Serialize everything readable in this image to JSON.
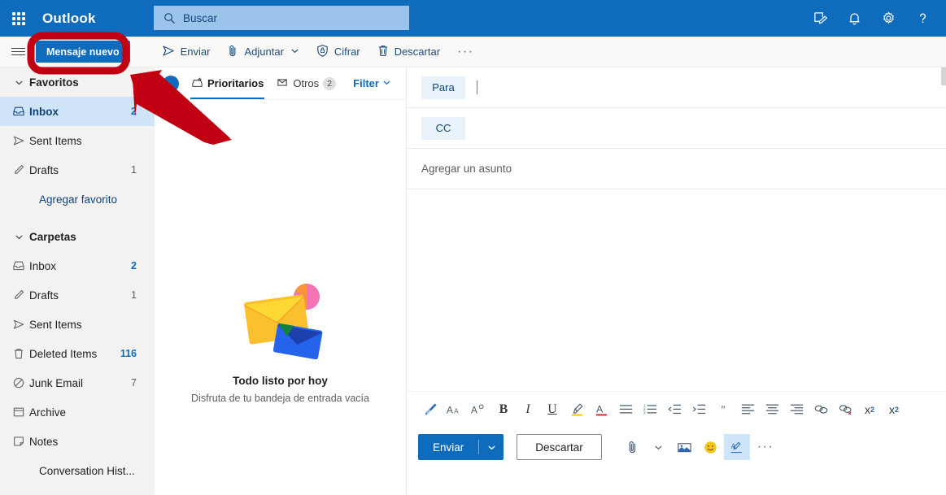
{
  "topbar": {
    "brand": "Outlook",
    "app_launcher_icon": "waffle-grid-icon",
    "search": {
      "placeholder": "Buscar",
      "value": "",
      "icon": "search-icon"
    },
    "icons": [
      {
        "name": "meeting-note-icon",
        "label": "Notas de reunión"
      },
      {
        "name": "bell-icon",
        "label": "Notificaciones"
      },
      {
        "name": "gear-icon",
        "label": "Configuración"
      },
      {
        "name": "help-icon",
        "label": "Ayuda"
      }
    ],
    "accent": "#0f6cbd",
    "search_bg": "#9cc3ea"
  },
  "commandbar": {
    "hamburger_icon": "hamburger-icon",
    "new_message_label": "Mensaje nuevo",
    "actions": [
      {
        "name": "send",
        "label": "Enviar",
        "icon": "send-arrow-icon",
        "chevron": false
      },
      {
        "name": "attach",
        "label": "Adjuntar",
        "icon": "paperclip-icon",
        "chevron": true
      },
      {
        "name": "encrypt",
        "label": "Cifrar",
        "icon": "shield-lock-icon",
        "chevron": false
      },
      {
        "name": "discard",
        "label": "Descartar",
        "icon": "trash-icon",
        "chevron": false
      }
    ],
    "overflow": "···"
  },
  "sidebar": {
    "favorites_group": {
      "label": "Favoritos",
      "chevron": "chevron-down-icon"
    },
    "favorites": [
      {
        "label": "Inbox",
        "count": "2",
        "icon": "inbox-icon",
        "selected": true,
        "count_blue": true
      },
      {
        "label": "Sent Items",
        "count": "",
        "icon": "send-arrow-icon",
        "selected": false,
        "count_blue": false
      },
      {
        "label": "Drafts",
        "count": "1",
        "icon": "pencil-icon",
        "selected": false,
        "count_blue": false
      }
    ],
    "add_favorite_label": "Agregar favorito",
    "folders_group": {
      "label": "Carpetas",
      "chevron": "chevron-down-icon"
    },
    "folders": [
      {
        "label": "Inbox",
        "count": "2",
        "icon": "inbox-icon",
        "count_blue": true
      },
      {
        "label": "Drafts",
        "count": "1",
        "icon": "pencil-icon",
        "count_blue": false
      },
      {
        "label": "Sent Items",
        "count": "",
        "icon": "send-arrow-icon",
        "count_blue": false
      },
      {
        "label": "Deleted Items",
        "count": "116",
        "icon": "trash-icon",
        "count_blue": true
      },
      {
        "label": "Junk Email",
        "count": "7",
        "icon": "block-icon",
        "count_blue": false
      },
      {
        "label": "Archive",
        "count": "",
        "icon": "archive-icon",
        "count_blue": false
      },
      {
        "label": "Notes",
        "count": "",
        "icon": "note-icon",
        "count_blue": false
      }
    ],
    "conversation_history_label": "Conversation Hist...",
    "selected_bg": "#cfe4f7"
  },
  "messagelist": {
    "select_all_icon": "select-circle-icon",
    "tabs": [
      {
        "label": "Prioritarios",
        "icon": "focused-inbox-icon",
        "badge": "",
        "active": true
      },
      {
        "label": "Otros",
        "icon": "other-inbox-icon",
        "badge": "2",
        "active": false
      }
    ],
    "filter": {
      "label": "Filter",
      "chevron": "chevron-down-icon"
    },
    "empty": {
      "illustration": "empty-inbox-envelopes-icon",
      "title": "Todo listo por hoy",
      "subtitle": "Disfruta de tu bandeja de entrada vacía"
    }
  },
  "compose": {
    "to": {
      "chip_label": "Para",
      "value": "",
      "focused": true
    },
    "cc": {
      "chip_label": "CC",
      "value": ""
    },
    "subject": {
      "placeholder": "Agregar un asunto",
      "value": ""
    },
    "body": {
      "value": ""
    },
    "format_tools": [
      {
        "name": "format-painter-icon",
        "glyph": ""
      },
      {
        "name": "grow-font-icon",
        "glyph": ""
      },
      {
        "name": "shrink-font-icon",
        "glyph": ""
      },
      {
        "name": "bold-icon",
        "glyph": "B"
      },
      {
        "name": "italic-icon",
        "glyph": "I"
      },
      {
        "name": "underline-icon",
        "glyph": "U"
      },
      {
        "name": "highlight-icon",
        "glyph": ""
      },
      {
        "name": "font-color-icon",
        "glyph": "A"
      },
      {
        "name": "bulleted-list-icon",
        "glyph": ""
      },
      {
        "name": "numbered-list-icon",
        "glyph": ""
      },
      {
        "name": "decrease-indent-icon",
        "glyph": ""
      },
      {
        "name": "increase-indent-icon",
        "glyph": ""
      },
      {
        "name": "quote-icon",
        "glyph": "”"
      },
      {
        "name": "align-left-icon",
        "glyph": ""
      },
      {
        "name": "align-center-icon",
        "glyph": ""
      },
      {
        "name": "align-right-icon",
        "glyph": ""
      },
      {
        "name": "insert-link-icon",
        "glyph": ""
      },
      {
        "name": "remove-link-icon",
        "glyph": ""
      },
      {
        "name": "superscript-icon",
        "glyph": "x"
      },
      {
        "name": "subscript-icon",
        "glyph": "x"
      }
    ],
    "actions": {
      "send_label": "Enviar",
      "send_chevron": "chevron-down-icon",
      "discard_label": "Descartar",
      "icons": [
        {
          "name": "paperclip-icon",
          "highlighted": false,
          "chevron": true
        },
        {
          "name": "insert-picture-icon",
          "highlighted": false,
          "chevron": false
        },
        {
          "name": "emoji-icon",
          "highlighted": false,
          "chevron": false
        },
        {
          "name": "signature-icon",
          "highlighted": true,
          "chevron": false
        }
      ],
      "overflow": "···"
    }
  },
  "annotation": {
    "highlight_target": "Mensaje nuevo",
    "shape": "red-rounded-rectangle-and-arrow",
    "color": "#c00012"
  }
}
